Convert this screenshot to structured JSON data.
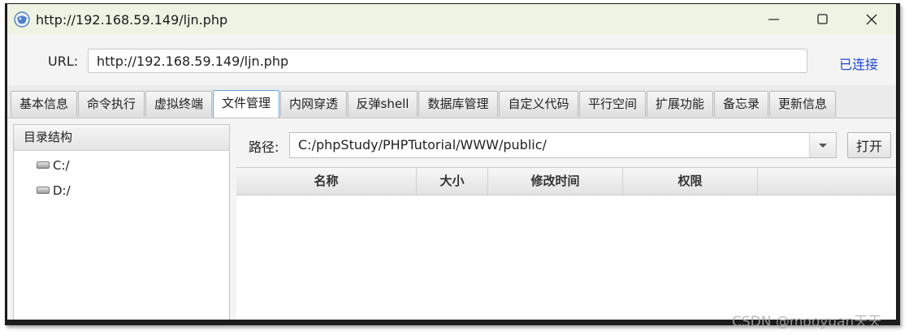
{
  "window": {
    "title": "http://192.168.59.149/ljn.php",
    "controls": {
      "minimize_icon": "minimize-icon",
      "maximize_icon": "maximize-icon",
      "close_icon": "close-icon"
    }
  },
  "urlbar": {
    "label": "URL:",
    "value": "http://192.168.59.149/ljn.php",
    "status": "已连接",
    "status_color": "#1f48d6"
  },
  "tabs": [
    {
      "label": "基本信息",
      "active": false
    },
    {
      "label": "命令执行",
      "active": false
    },
    {
      "label": "虚拟终端",
      "active": false
    },
    {
      "label": "文件管理",
      "active": true
    },
    {
      "label": "内网穿透",
      "active": false
    },
    {
      "label": "反弹shell",
      "active": false
    },
    {
      "label": "数据库管理",
      "active": false
    },
    {
      "label": "自定义代码",
      "active": false
    },
    {
      "label": "平行空间",
      "active": false
    },
    {
      "label": "扩展功能",
      "active": false
    },
    {
      "label": "备忘录",
      "active": false
    },
    {
      "label": "更新信息",
      "active": false
    }
  ],
  "directory_panel": {
    "title": "目录结构",
    "items": [
      {
        "label": "C:/",
        "icon": "drive-icon"
      },
      {
        "label": "D:/",
        "icon": "drive-icon"
      }
    ]
  },
  "path_bar": {
    "label": "路径:",
    "value": "C:/phpStudy/PHPTutorial/WWW/public/",
    "open_button": "打开"
  },
  "file_table": {
    "columns": [
      "名称",
      "大小",
      "修改时间",
      "权限"
    ],
    "rows": []
  },
  "watermark": "CSDN @mooyuan天天"
}
